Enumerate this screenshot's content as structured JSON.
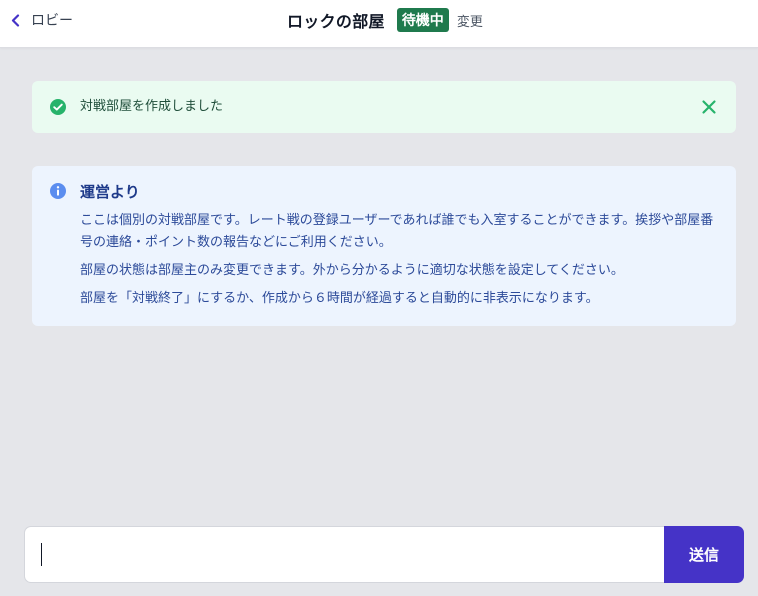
{
  "header": {
    "back_label": "ロビー",
    "room_title": "ロックの部屋",
    "status_badge": "待機中",
    "change_label": "変更"
  },
  "success_alert": {
    "message": "対戦部屋を作成しました",
    "icon": "check-circle-icon",
    "close_icon": "close-icon"
  },
  "info_alert": {
    "icon": "info-circle-icon",
    "title": "運営より",
    "paragraphs": [
      "ここは個別の対戦部屋です。レート戦の登録ユーザーであれば誰でも入室することができます。挨拶や部屋番号の連絡・ポイント数の報告などにご利用ください。",
      "部屋の状態は部屋主のみ変更できます。外から分かるように適切な状態を設定してください。",
      "部屋を「対戦終了」にするか、作成から６時間が経過すると自動的に非表示になります。"
    ]
  },
  "composer": {
    "input_value": "",
    "input_placeholder": "",
    "send_label": "送信"
  },
  "colors": {
    "accent": "#4533c7",
    "badge": "#1f7a4d",
    "success_bg": "#eafbf1",
    "success_icon": "#27b36b",
    "info_bg": "#edf4fe",
    "info_icon": "#5b8def"
  }
}
